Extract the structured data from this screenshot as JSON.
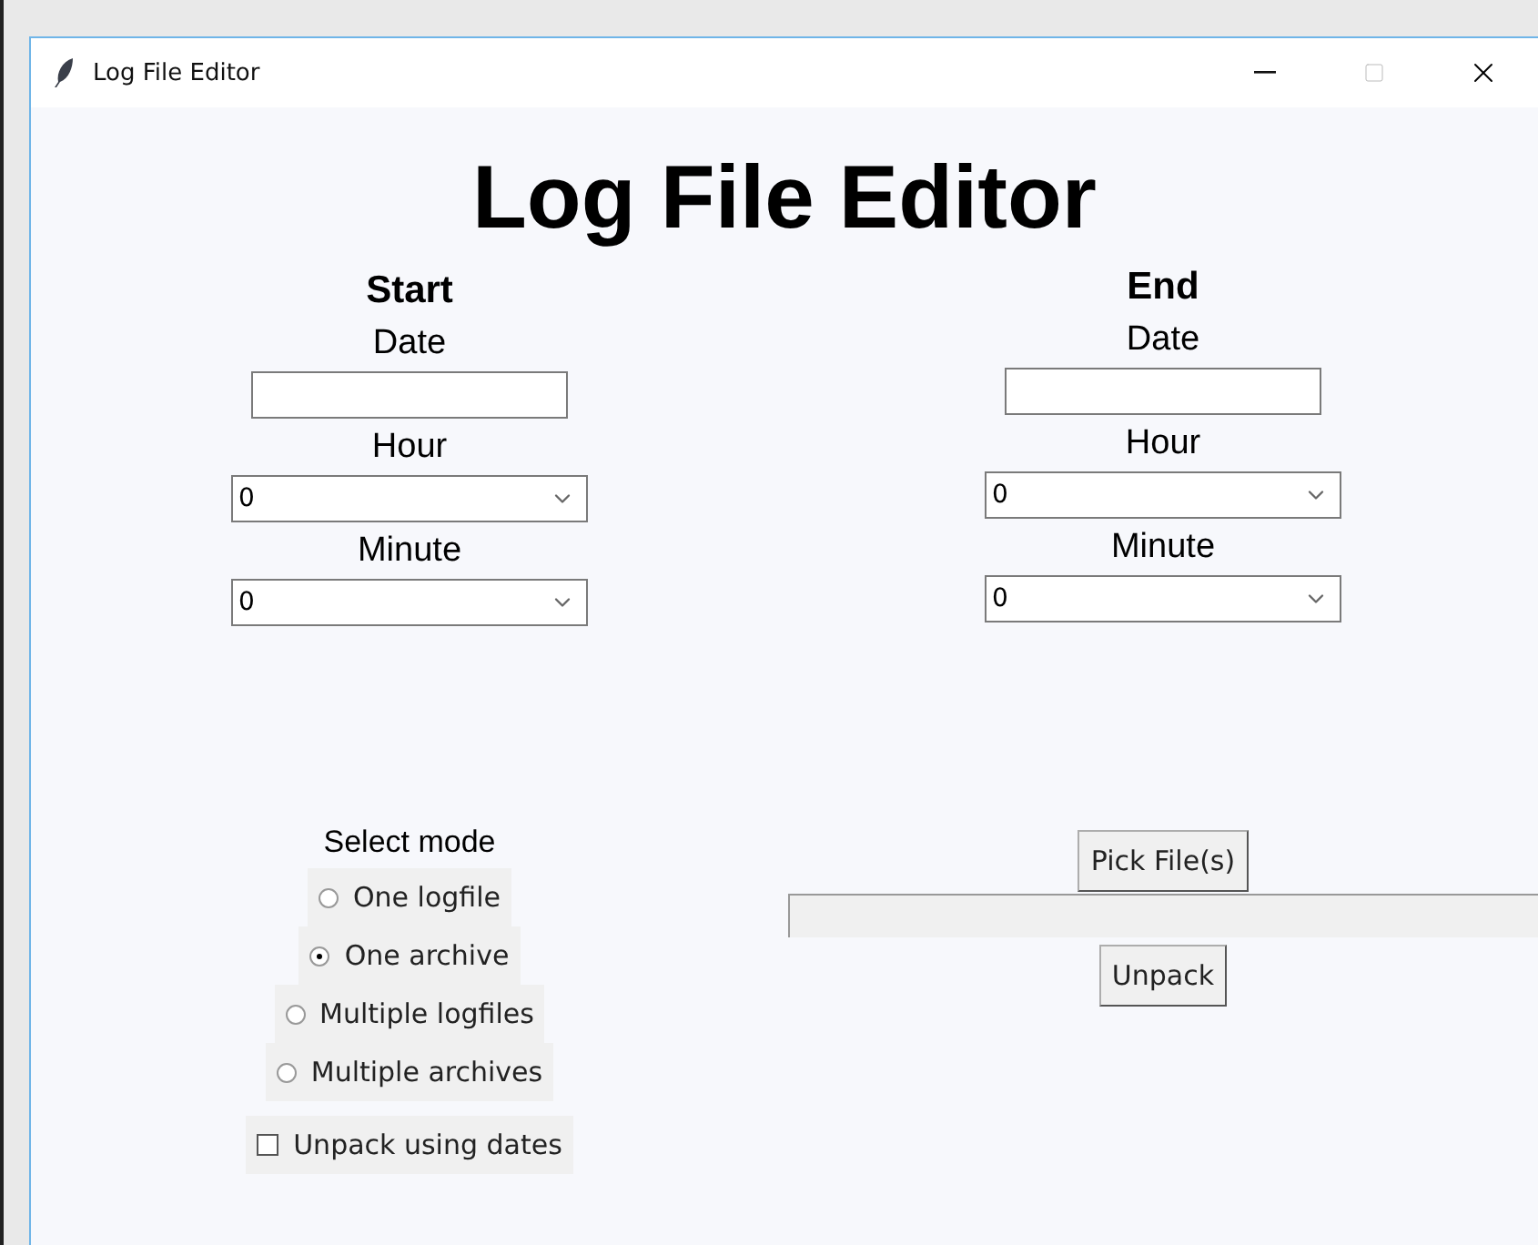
{
  "window": {
    "title": "Log File Editor"
  },
  "heading": "Log File Editor",
  "ranges": [
    {
      "title": "Start",
      "date_label": "Date",
      "hour_label": "Hour",
      "hour_value": "0",
      "minute_label": "Minute",
      "minute_value": "0"
    },
    {
      "title": "End",
      "date_label": "Date",
      "hour_label": "Hour",
      "hour_value": "0",
      "minute_label": "Minute",
      "minute_value": "0"
    }
  ],
  "mode": {
    "label": "Select mode",
    "options": [
      {
        "label": "One logfile",
        "selected": false
      },
      {
        "label": "One archive",
        "selected": true
      },
      {
        "label": "Multiple logfiles",
        "selected": false
      },
      {
        "label": "Multiple archives",
        "selected": false
      }
    ]
  },
  "unpack_using_dates": {
    "label": "Unpack using dates",
    "checked": false
  },
  "pick_button": "Pick File(s)",
  "unpack_button": "Unpack"
}
